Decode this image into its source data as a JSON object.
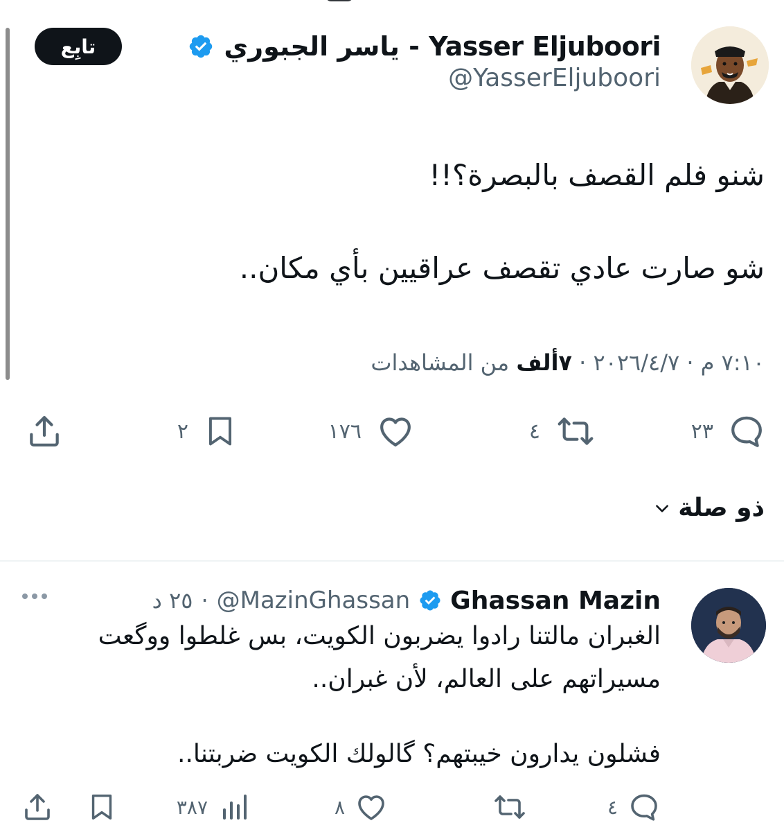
{
  "main_tweet": {
    "author": {
      "display_name": "ياسر الجبوري - Yasser Eljuboori",
      "handle": "@YasserEljuboori"
    },
    "follow_label": "تابِع",
    "text_line1": "شنو فلم القصف بالبصرة؟!!",
    "text_line2": "شو صارت عادي تقصف عراقيين بأي مكان..",
    "timestamp": "٧:١٠ م · ٢٠٢٦/٤/٧ · ",
    "views_count": "٧ألف",
    "views_label": " من المشاهدات",
    "stats": {
      "replies": "٢٣",
      "retweets": "٤",
      "likes": "١٧٦",
      "bookmarks": "٢"
    }
  },
  "thread_link": {
    "label": "ذو صلة"
  },
  "reply_tweet": {
    "author": {
      "display_name": "Ghassan Mazin",
      "handle": "@MazinGhassan"
    },
    "separator": "·",
    "time": "٢٥ د",
    "text_line1": "الغبران مالتنا رادوا يضربون الكويت، بس غلطوا ووگعت",
    "text_line2": "مسيراتهم على العالم، لأن غبران..",
    "text_line3": "فشلون يدارون خيبتهم؟ گالولك الكويت ضربتنا..",
    "stats": {
      "replies": "٤",
      "retweets": "",
      "likes": "٨",
      "views": "٣٨٧"
    }
  },
  "colors": {
    "verified_blue": "#1d9bf0",
    "text_primary": "#0f1419",
    "text_secondary": "#536471"
  },
  "icons": [
    "verified-badge-icon",
    "reply-icon",
    "retweet-icon",
    "like-icon",
    "bookmark-icon",
    "share-icon",
    "views-icon",
    "chevron-down-icon",
    "more-icon"
  ]
}
